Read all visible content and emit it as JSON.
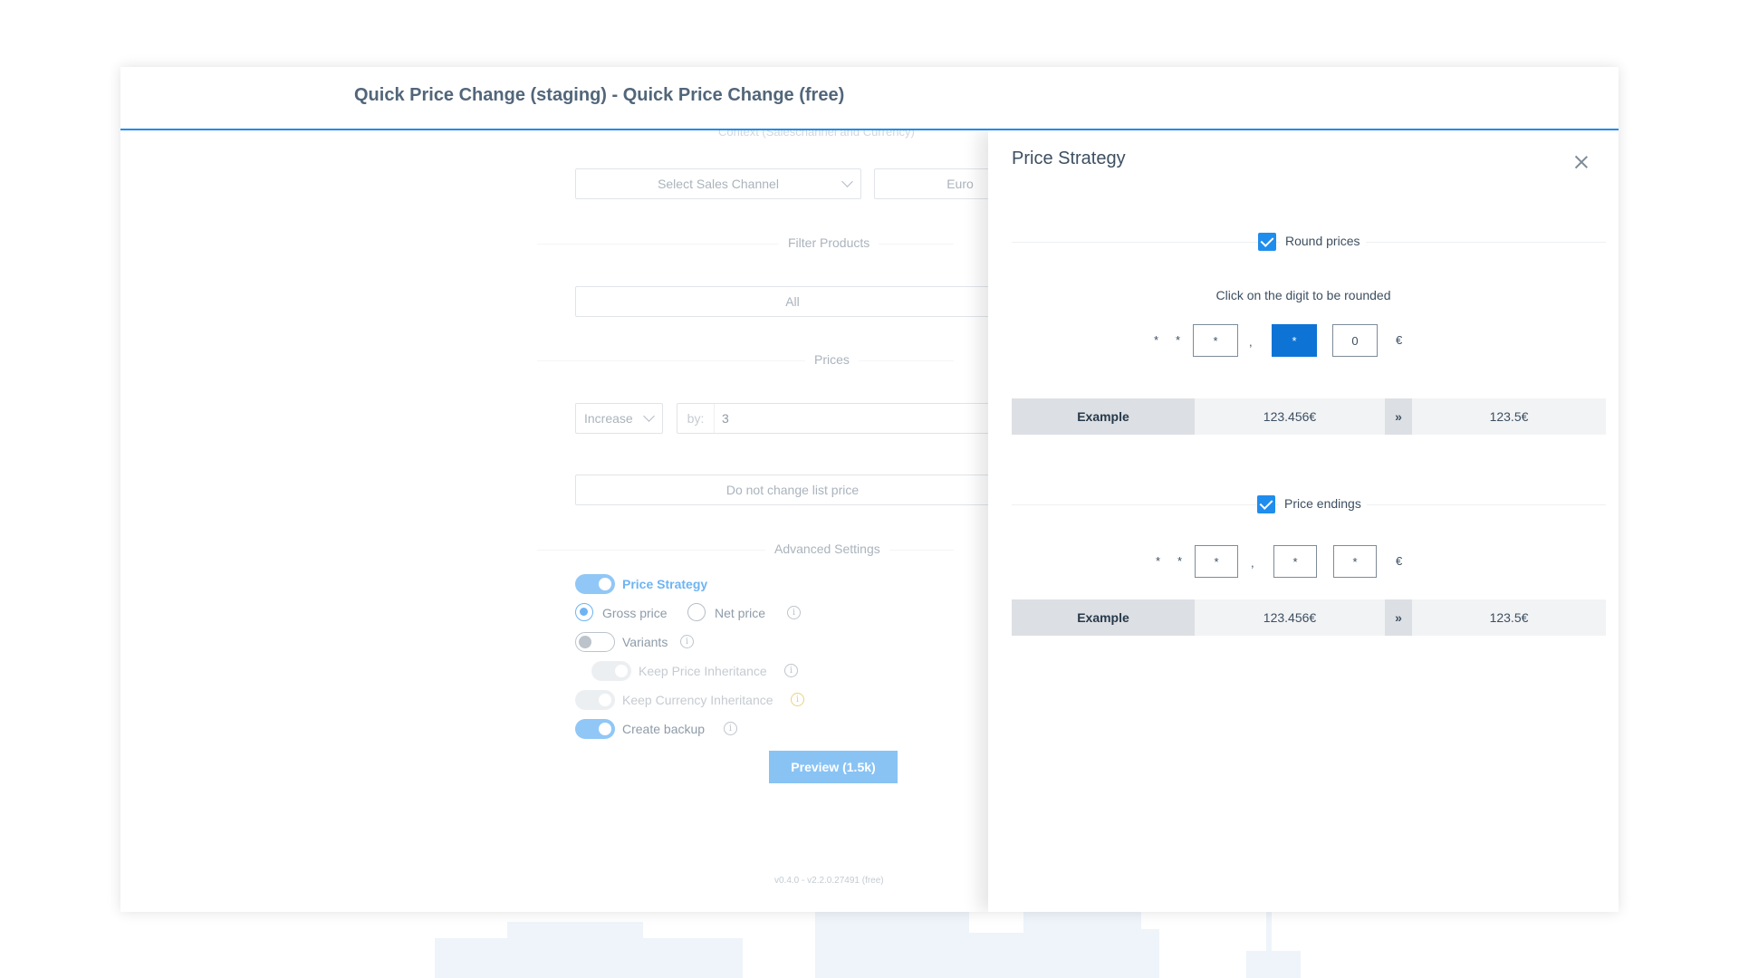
{
  "window": {
    "title": "Quick Price Change (staging) - Quick Price Change (free)"
  },
  "form": {
    "context_label": "Context (Saleschannel and Currency)",
    "sales_channel_placeholder": "Select Sales Channel",
    "currency_value": "Euro",
    "filter_section": "Filter Products",
    "filter_value": "All",
    "prices_section": "Prices",
    "direction_value": "Increase",
    "by_label": "by:",
    "by_value": "3",
    "list_price_value": "Do not change list price",
    "advanced_section": "Advanced Settings",
    "price_strategy_label": "Price Strategy",
    "gross_price_label": "Gross price",
    "net_price_label": "Net price",
    "variants_label": "Variants",
    "keep_price_inheritance_label": "Keep Price Inheritance",
    "keep_currency_inheritance_label": "Keep Currency Inheritance",
    "create_backup_label": "Create backup",
    "preview_button": "Preview (1.5k)",
    "version": "v0.4.0 - v2.2.0.27491 (free)"
  },
  "drawer": {
    "title": "Price Strategy",
    "round_prices_label": "Round prices",
    "round_hint": "Click on the digit to be rounded",
    "star": "*",
    "comma": ",",
    "currency_symbol": "€",
    "round_digits": [
      "*",
      "*",
      "0"
    ],
    "endings_digits": [
      "*",
      "*",
      "*"
    ],
    "price_endings_label": "Price endings",
    "example_label": "Example",
    "example_in": "123.456€",
    "arrow": "»",
    "example_out": "123.5€",
    "example2_in": "123.456€",
    "example2_out": "123.5€"
  },
  "colors": {
    "accent": "#1f8ded",
    "active_digit": "#0d74d6"
  }
}
